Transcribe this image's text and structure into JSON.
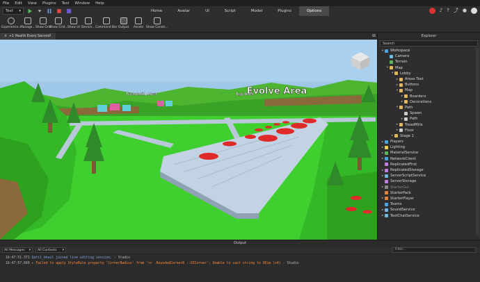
{
  "menu": [
    "File",
    "Edit",
    "View",
    "Plugins",
    "Test",
    "Window",
    "Help"
  ],
  "toolbar": {
    "mode": "Test",
    "tabs": [
      "Home",
      "Avatar",
      "UI",
      "Script",
      "Model",
      "Plugins",
      "Options"
    ],
    "active_tab": "Options"
  },
  "ribbon": [
    {
      "label": "Experience...",
      "icon": "gear-icon"
    },
    {
      "label": "Manage...",
      "icon": "box-icon"
    },
    {
      "label": "Show Grid",
      "icon": "grid-icon"
    },
    {
      "label": "Show Grid...",
      "icon": "grid-icon"
    },
    {
      "label": "Show UI",
      "icon": "ui-icon"
    },
    {
      "label": "Device...",
      "icon": "device-icon"
    },
    {
      "label": "Command Bar",
      "icon": "command-icon"
    },
    {
      "label": "Output",
      "icon": "output-icon"
    },
    {
      "label": "Assets",
      "icon": "assets-icon"
    },
    {
      "label": "Show Constr...",
      "icon": "constraint-icon"
    }
  ],
  "doc_tab": "+1 Health Every Second!",
  "viewport": {
    "label_main": "Evolve Area",
    "label_treadmill": "Treadmill Area",
    "label_egg": "Egg Area"
  },
  "explorer": {
    "title": "Explorer",
    "search_placeholder": "Search",
    "items": [
      {
        "label": "Workspace",
        "depth": 0,
        "arrow": "▾",
        "color": "#4aa3df"
      },
      {
        "label": "Camera",
        "depth": 1,
        "arrow": "",
        "color": "#6fb7e0"
      },
      {
        "label": "Terrain",
        "depth": 1,
        "arrow": "",
        "color": "#5cb85c"
      },
      {
        "label": "Map",
        "depth": 1,
        "arrow": "▾",
        "color": "#e0b85c"
      },
      {
        "label": "Lobby",
        "depth": 2,
        "arrow": "▾",
        "color": "#e0b85c"
      },
      {
        "label": "Areas Text",
        "depth": 3,
        "arrow": "▸",
        "color": "#e0b85c"
      },
      {
        "label": "Buttons",
        "depth": 3,
        "arrow": "▸",
        "color": "#e0b85c"
      },
      {
        "label": "Map",
        "depth": 3,
        "arrow": "▾",
        "color": "#e0b85c"
      },
      {
        "label": "Boarders",
        "depth": 4,
        "arrow": "▸",
        "color": "#e0b85c"
      },
      {
        "label": "Decorations",
        "depth": 4,
        "arrow": "▸",
        "color": "#e0b85c"
      },
      {
        "label": "Path",
        "depth": 3,
        "arrow": "▾",
        "color": "#e0b85c"
      },
      {
        "label": "Spawn",
        "depth": 4,
        "arrow": "",
        "color": "#cccccc"
      },
      {
        "label": "Path",
        "depth": 4,
        "arrow": "▸",
        "color": "#cccccc"
      },
      {
        "label": "TreadMills",
        "depth": 3,
        "arrow": "▸",
        "color": "#e0b85c"
      },
      {
        "label": "Floor",
        "depth": 3,
        "arrow": "▸",
        "color": "#cccccc"
      },
      {
        "label": "Stage 1",
        "depth": 2,
        "arrow": "▸",
        "color": "#e0b85c"
      },
      {
        "label": "Players",
        "depth": 0,
        "arrow": "▸",
        "color": "#4aa3df"
      },
      {
        "label": "Lighting",
        "depth": 0,
        "arrow": "▸",
        "color": "#f0d050"
      },
      {
        "label": "MaterialService",
        "depth": 0,
        "arrow": "▸",
        "color": "#5cb85c"
      },
      {
        "label": "NetworkClient",
        "depth": 0,
        "arrow": "▸",
        "color": "#4aa3df"
      },
      {
        "label": "ReplicatedFirst",
        "depth": 0,
        "arrow": "",
        "color": "#c080e0"
      },
      {
        "label": "ReplicatedStorage",
        "depth": 0,
        "arrow": "▸",
        "color": "#c080e0"
      },
      {
        "label": "ServerScriptService",
        "depth": 0,
        "arrow": "▸",
        "color": "#6fb7e0"
      },
      {
        "label": "ServerStorage",
        "depth": 0,
        "arrow": "",
        "color": "#c080e0"
      },
      {
        "label": "StarterGui",
        "depth": 0,
        "arrow": "▸",
        "color": "#888888",
        "dim": true
      },
      {
        "label": "StarterPack",
        "depth": 0,
        "arrow": "",
        "color": "#e08040"
      },
      {
        "label": "StarterPlayer",
        "depth": 0,
        "arrow": "▸",
        "color": "#e08040"
      },
      {
        "label": "Teams",
        "depth": 0,
        "arrow": "",
        "color": "#4aa3df"
      },
      {
        "label": "SoundService",
        "depth": 0,
        "arrow": "▸",
        "color": "#6fb7e0"
      },
      {
        "label": "TextChatService",
        "depth": 0,
        "arrow": "▸",
        "color": "#6fb7e0"
      }
    ]
  },
  "output": {
    "title": "Output",
    "filter_messages": "All Messages",
    "filter_contexts": "All Contexts",
    "filter_placeholder": "Filter...",
    "lines": [
      {
        "time": "16:47:51.371",
        "msg": "Qatil_bhail joined live editing session.",
        "src": " - Studio",
        "kind": "info"
      },
      {
        "time": "16:47:57.669",
        "msg": "▸ Failed to apply StyleRule property 'CornerRadius' from '>> .RoundedCorner8 ::UICorner': Unable to cast string to UDim (x4)",
        "src": " - Studio",
        "kind": "warn"
      }
    ]
  },
  "colors": {
    "grass": "#3fcf2f",
    "path": "#b8c8d8",
    "pad": "#e02a2a",
    "sky": "#9ec7e8"
  }
}
